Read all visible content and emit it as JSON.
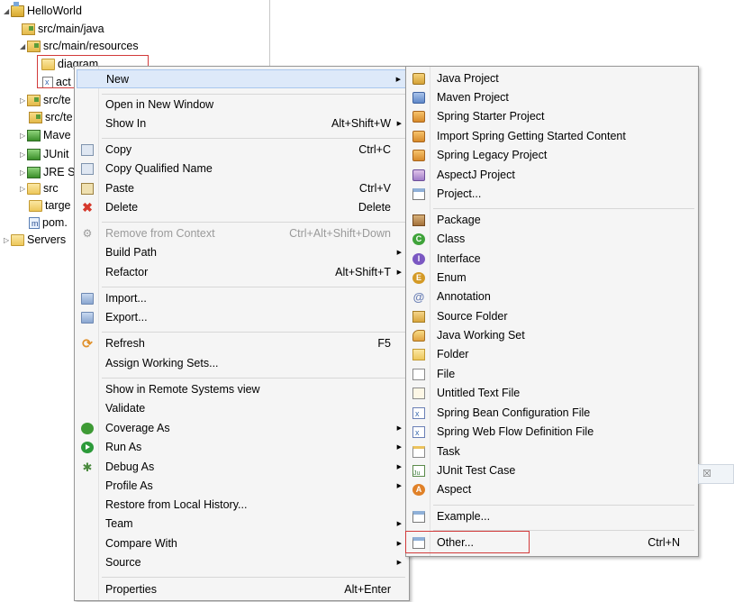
{
  "tree": {
    "items": [
      {
        "label": "HelloWorld",
        "icon": "maven-project-icon",
        "indent": 0,
        "twisty": "expanded"
      },
      {
        "label": "src/main/java",
        "icon": "source-folder-icon",
        "indent": 1,
        "twisty": ""
      },
      {
        "label": "src/main/resources",
        "icon": "source-folder-icon",
        "indent": 1,
        "twisty": "expanded"
      },
      {
        "label": "diagram",
        "icon": "folder-icon",
        "indent": 2,
        "twisty": ""
      },
      {
        "label": "act",
        "icon": "xml-file-icon",
        "indent": 2,
        "twisty": ""
      },
      {
        "label": "src/te",
        "icon": "source-folder-icon",
        "indent": 1,
        "twisty": "collapsed"
      },
      {
        "label": "src/te",
        "icon": "source-folder-icon",
        "indent": 1,
        "twisty": ""
      },
      {
        "label": "Mave",
        "icon": "library-icon",
        "indent": 1,
        "twisty": "collapsed"
      },
      {
        "label": "JUnit",
        "icon": "library-icon",
        "indent": 1,
        "twisty": "collapsed"
      },
      {
        "label": "JRE S",
        "icon": "library-icon",
        "indent": 1,
        "twisty": "collapsed"
      },
      {
        "label": "src",
        "icon": "folder-icon",
        "indent": 1,
        "twisty": "collapsed"
      },
      {
        "label": "targe",
        "icon": "folder-icon",
        "indent": 1,
        "twisty": ""
      },
      {
        "label": "pom.",
        "icon": "pom-file-icon",
        "indent": 1,
        "twisty": ""
      },
      {
        "label": "Servers",
        "icon": "folder-icon",
        "indent": 0,
        "twisty": "collapsed"
      }
    ]
  },
  "context_menu": {
    "new": {
      "label": "New"
    },
    "open_new_window": {
      "label": "Open in New Window"
    },
    "show_in": {
      "label": "Show In",
      "shortcut": "Alt+Shift+W"
    },
    "copy": {
      "label": "Copy",
      "shortcut": "Ctrl+C"
    },
    "copy_qualified": {
      "label": "Copy Qualified Name"
    },
    "paste": {
      "label": "Paste",
      "shortcut": "Ctrl+V"
    },
    "delete": {
      "label": "Delete",
      "shortcut": "Delete"
    },
    "remove_context": {
      "label": "Remove from Context",
      "shortcut": "Ctrl+Alt+Shift+Down"
    },
    "build_path": {
      "label": "Build Path"
    },
    "refactor": {
      "label": "Refactor",
      "shortcut": "Alt+Shift+T"
    },
    "import": {
      "label": "Import..."
    },
    "export": {
      "label": "Export..."
    },
    "refresh": {
      "label": "Refresh",
      "shortcut": "F5"
    },
    "assign_working_sets": {
      "label": "Assign Working Sets..."
    },
    "show_remote": {
      "label": "Show in Remote Systems view"
    },
    "validate": {
      "label": "Validate"
    },
    "coverage_as": {
      "label": "Coverage As"
    },
    "run_as": {
      "label": "Run As"
    },
    "debug_as": {
      "label": "Debug As"
    },
    "profile_as": {
      "label": "Profile As"
    },
    "restore_history": {
      "label": "Restore from Local History..."
    },
    "team": {
      "label": "Team"
    },
    "compare_with": {
      "label": "Compare With"
    },
    "source": {
      "label": "Source"
    },
    "properties": {
      "label": "Properties",
      "shortcut": "Alt+Enter"
    }
  },
  "submenu": {
    "java_project": {
      "label": "Java Project"
    },
    "maven_project": {
      "label": "Maven Project"
    },
    "spring_starter": {
      "label": "Spring Starter Project"
    },
    "import_spring": {
      "label": "Import Spring Getting Started Content"
    },
    "spring_legacy": {
      "label": "Spring Legacy Project"
    },
    "aspectj_project": {
      "label": "AspectJ Project"
    },
    "project": {
      "label": "Project..."
    },
    "package": {
      "label": "Package"
    },
    "class": {
      "label": "Class"
    },
    "interface": {
      "label": "Interface"
    },
    "enum": {
      "label": "Enum"
    },
    "annotation": {
      "label": "Annotation"
    },
    "source_folder": {
      "label": "Source Folder"
    },
    "java_working_set": {
      "label": "Java Working Set"
    },
    "folder": {
      "label": "Folder"
    },
    "file": {
      "label": "File"
    },
    "untitled_text": {
      "label": "Untitled Text File"
    },
    "spring_bean": {
      "label": "Spring Bean Configuration File"
    },
    "spring_webflow": {
      "label": "Spring Web Flow Definition File"
    },
    "task": {
      "label": "Task"
    },
    "junit_test": {
      "label": "JUnit Test Case"
    },
    "aspect": {
      "label": "Aspect"
    },
    "example": {
      "label": "Example..."
    },
    "other": {
      "label": "Other...",
      "shortcut": "Ctrl+N"
    }
  },
  "close_tab_glyph": "☒"
}
